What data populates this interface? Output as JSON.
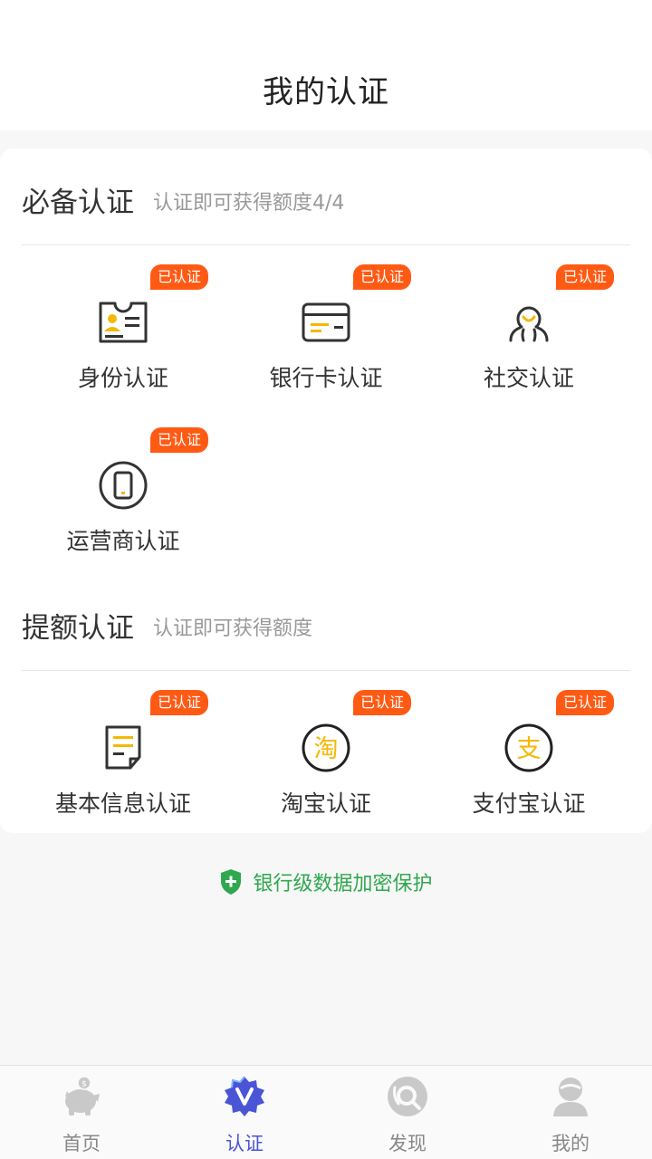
{
  "header": {
    "title": "我的认证"
  },
  "required": {
    "title": "必备认证",
    "subtitle": "认证即可获得额度4/4",
    "items": [
      {
        "label": "身份认证",
        "badge": "已认证",
        "icon": "id-card-icon"
      },
      {
        "label": "银行卡认证",
        "badge": "已认证",
        "icon": "bank-card-icon"
      },
      {
        "label": "社交认证",
        "badge": "已认证",
        "icon": "social-icon"
      },
      {
        "label": "运营商认证",
        "badge": "已认证",
        "icon": "phone-icon"
      }
    ]
  },
  "boost": {
    "title": "提额认证",
    "subtitle": "认证即可获得额度",
    "items": [
      {
        "label": "基本信息认证",
        "badge": "已认证",
        "icon": "document-icon"
      },
      {
        "label": "淘宝认证",
        "badge": "已认证",
        "icon": "taobao-icon",
        "glyph": "淘"
      },
      {
        "label": "支付宝认证",
        "badge": "已认证",
        "icon": "alipay-icon",
        "glyph": "支"
      }
    ]
  },
  "security": {
    "text": "银行级数据加密保护"
  },
  "colors": {
    "accent": "#4a55d6",
    "badge": "#ff5a14",
    "gold": "#f5b800",
    "green": "#2fa84f"
  },
  "tabbar": {
    "tabs": [
      {
        "label": "首页",
        "icon": "piggy-bank-icon",
        "active": false
      },
      {
        "label": "认证",
        "icon": "verify-badge-icon",
        "active": true
      },
      {
        "label": "发现",
        "icon": "discover-icon",
        "active": false
      },
      {
        "label": "我的",
        "icon": "user-icon",
        "active": false
      }
    ]
  }
}
